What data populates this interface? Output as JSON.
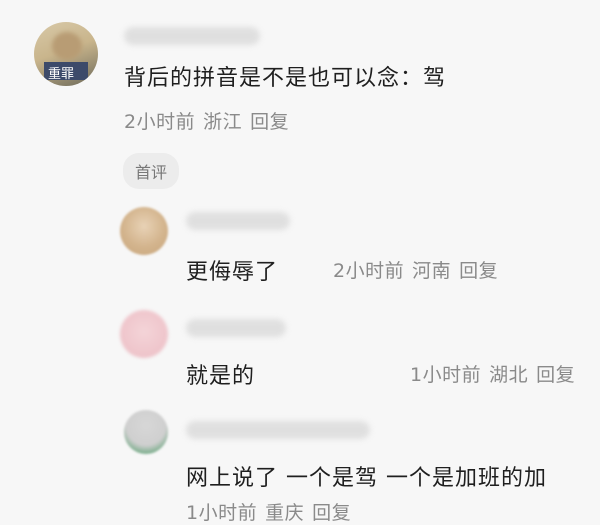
{
  "comment": {
    "text": "背后的拼音是不是也可以念：驾",
    "time": "2小时前",
    "region": "浙江",
    "reply": "回复",
    "tag": "首评",
    "avatar_text": "重罪"
  },
  "replies": [
    {
      "text": "更侮辱了",
      "time": "2小时前",
      "region": "河南",
      "reply": "回复"
    },
    {
      "text": "就是的",
      "time": "1小时前",
      "region": "湖北",
      "reply": "回复"
    },
    {
      "text": "网上说了 一个是驾 一个是加班的加",
      "time": "1小时前",
      "region": "重庆",
      "reply": "回复"
    }
  ],
  "colors": {
    "background": "#f7f7f7",
    "text": "#1f1f1f",
    "meta": "#8a8a8a"
  }
}
